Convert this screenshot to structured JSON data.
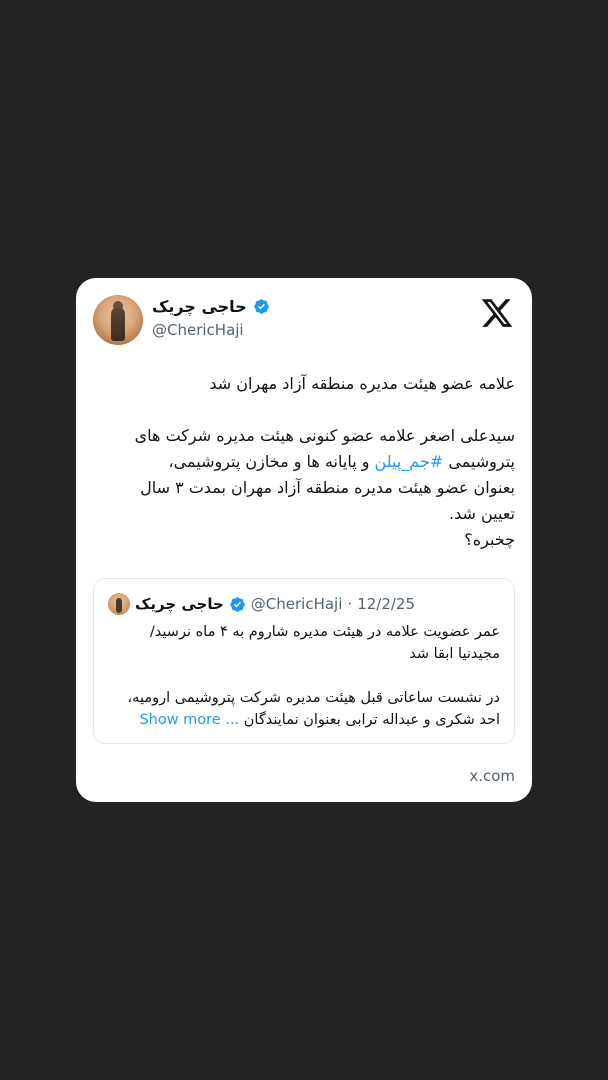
{
  "tweet": {
    "author_name": "حاجی چریک",
    "author_handle": "@ChericHaji",
    "title_line": "علامه عضو هیئت مدیره منطقه آزاد مهران شد",
    "body_part1": "سیدعلی اصغر علامه عضو کنونی هیئت مدیره شرکت های\nپتروشیمی ",
    "hashtag": "#جم_پیلن",
    "body_part2": " و پایانه ها و مخازن پتروشیمی،\nبعنوان عضو هیئت مدیره منطقه آزاد مهران بمدت ۳ سال\nتعیین شد.\nچخبره؟"
  },
  "quote": {
    "author_name": "حاجی چریک",
    "author_handle": "@ChericHaji",
    "separator": "·",
    "date": "12/2/25",
    "text": "عمر عضویت علامه در هیئت مدیره شاروم به ۴ ماه نرسید/\nمجیدنیا ابقا شد\n\nدر نشست ساعاتی قبل هیئت مدیره شرکت پتروشیمی ارومیه،\nاحد شکری و عبداله ترابی بعنوان نمایندگان ",
    "show_more": "... Show more"
  },
  "footer": {
    "link": "x.com"
  },
  "colors": {
    "background": "#232323",
    "card": "#ffffff",
    "accent": "#1d9bf0",
    "muted": "#536471"
  },
  "icons": {
    "verified": "verified-badge-icon",
    "brand": "x-logo-icon"
  }
}
